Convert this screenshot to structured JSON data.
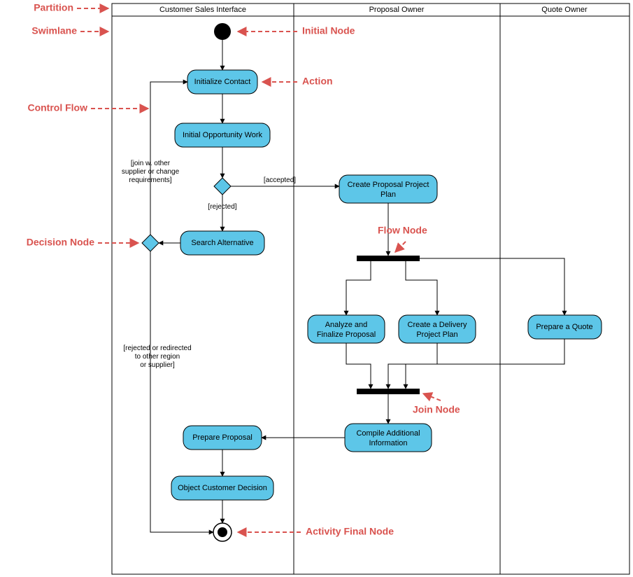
{
  "lanes": {
    "lane1": "Customer Sales Interface",
    "lane2": "Proposal Owner",
    "lane3": "Quote Owner"
  },
  "actions": {
    "a1": "Initialize Contact",
    "a2": "Initial Opportunity Work",
    "a3": "Search Alternative",
    "a4_l1": "Create Proposal Project",
    "a4_l2": "Plan",
    "a5_l1": "Analyze and",
    "a5_l2": "Finalize Proposal",
    "a6_l1": "Create a Delivery",
    "a6_l2": "Project Plan",
    "a7": "Prepare a Quote",
    "a8_l1": "Compile Additional",
    "a8_l2": "Information",
    "a9": "Prepare Proposal",
    "a10": "Object Customer Decision"
  },
  "guards": {
    "accepted": "[accepted]",
    "rejected": "[rejected]",
    "join_l1": "[join w. other",
    "join_l2": "supplier or change",
    "join_l3": "requirements]",
    "rr_l1": "[rejected or redirected",
    "rr_l2": "to other region",
    "rr_l3": "or supplier]"
  },
  "annotations": {
    "partition": "Partition",
    "swimlane": "Swimlane",
    "control_flow": "Control Flow",
    "decision_node": "Decision Node",
    "initial_node": "Initial Node",
    "action": "Action",
    "flow_node": "Flow Node",
    "join_node": "Join Node",
    "final_node": "Activity Final Node"
  }
}
